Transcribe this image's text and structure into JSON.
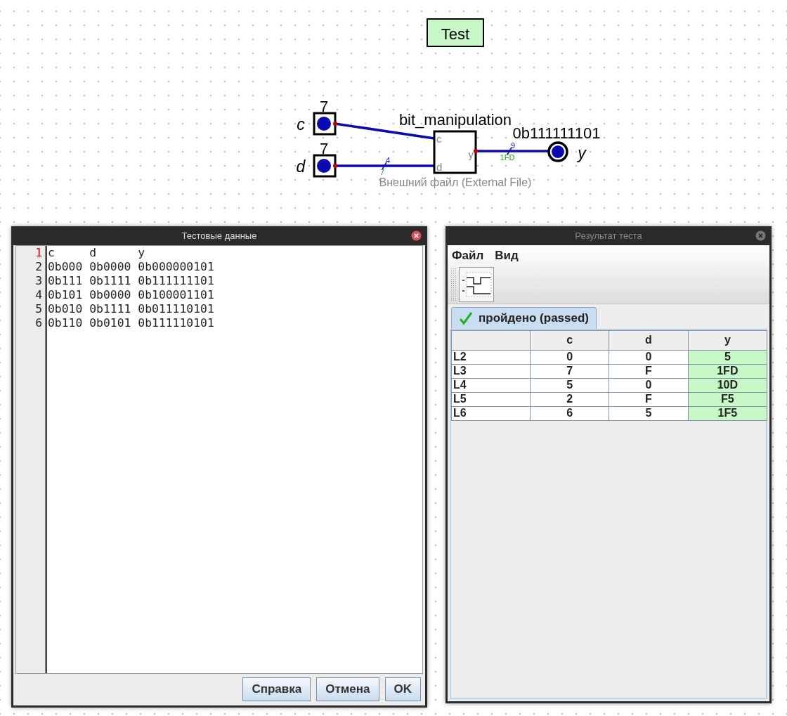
{
  "circuit": {
    "test_label": "Test",
    "inputs": [
      {
        "name": "c",
        "value": "7"
      },
      {
        "name": "d",
        "value": "7"
      }
    ],
    "component": {
      "name": "bit_manipulation",
      "ports": [
        "c",
        "d",
        "y"
      ],
      "caption": "Внешний файл (External File)"
    },
    "wires": [
      {
        "bits": "4",
        "value": "7"
      },
      {
        "bits": "9",
        "value": "1FD"
      }
    ],
    "output": {
      "name": "y",
      "value": "0b111111101"
    }
  },
  "test_data_window": {
    "title": "Тестовые данные",
    "lines": [
      {
        "number": "1",
        "text": "c     d      y",
        "current": true
      },
      {
        "number": "2",
        "text": "0b000 0b0000 0b000000101",
        "current": false
      },
      {
        "number": "3",
        "text": "0b111 0b1111 0b111111101",
        "current": false
      },
      {
        "number": "4",
        "text": "0b101 0b0000 0b100001101",
        "current": false
      },
      {
        "number": "5",
        "text": "0b010 0b1111 0b011110101",
        "current": false
      },
      {
        "number": "6",
        "text": "0b110 0b0101 0b111110101",
        "current": false
      }
    ],
    "buttons": [
      "Справка",
      "Отмена",
      "OK"
    ]
  },
  "result_window": {
    "title": "Результат теста",
    "menu": [
      "Файл",
      "Вид"
    ],
    "tabs": [
      {
        "label": "пройдено (passed)",
        "selected": true
      }
    ],
    "table": {
      "columns": [
        "",
        "c",
        "d",
        "y"
      ],
      "rows": [
        {
          "cells": [
            "L2",
            "0",
            "0",
            "5"
          ],
          "passed": true
        },
        {
          "cells": [
            "L3",
            "7",
            "F",
            "1FD"
          ],
          "passed": true
        },
        {
          "cells": [
            "L4",
            "5",
            "0",
            "10D"
          ],
          "passed": true
        },
        {
          "cells": [
            "L5",
            "2",
            "F",
            "F5"
          ],
          "passed": true
        },
        {
          "cells": [
            "L6",
            "6",
            "5",
            "1F5"
          ],
          "passed": true
        }
      ]
    }
  }
}
